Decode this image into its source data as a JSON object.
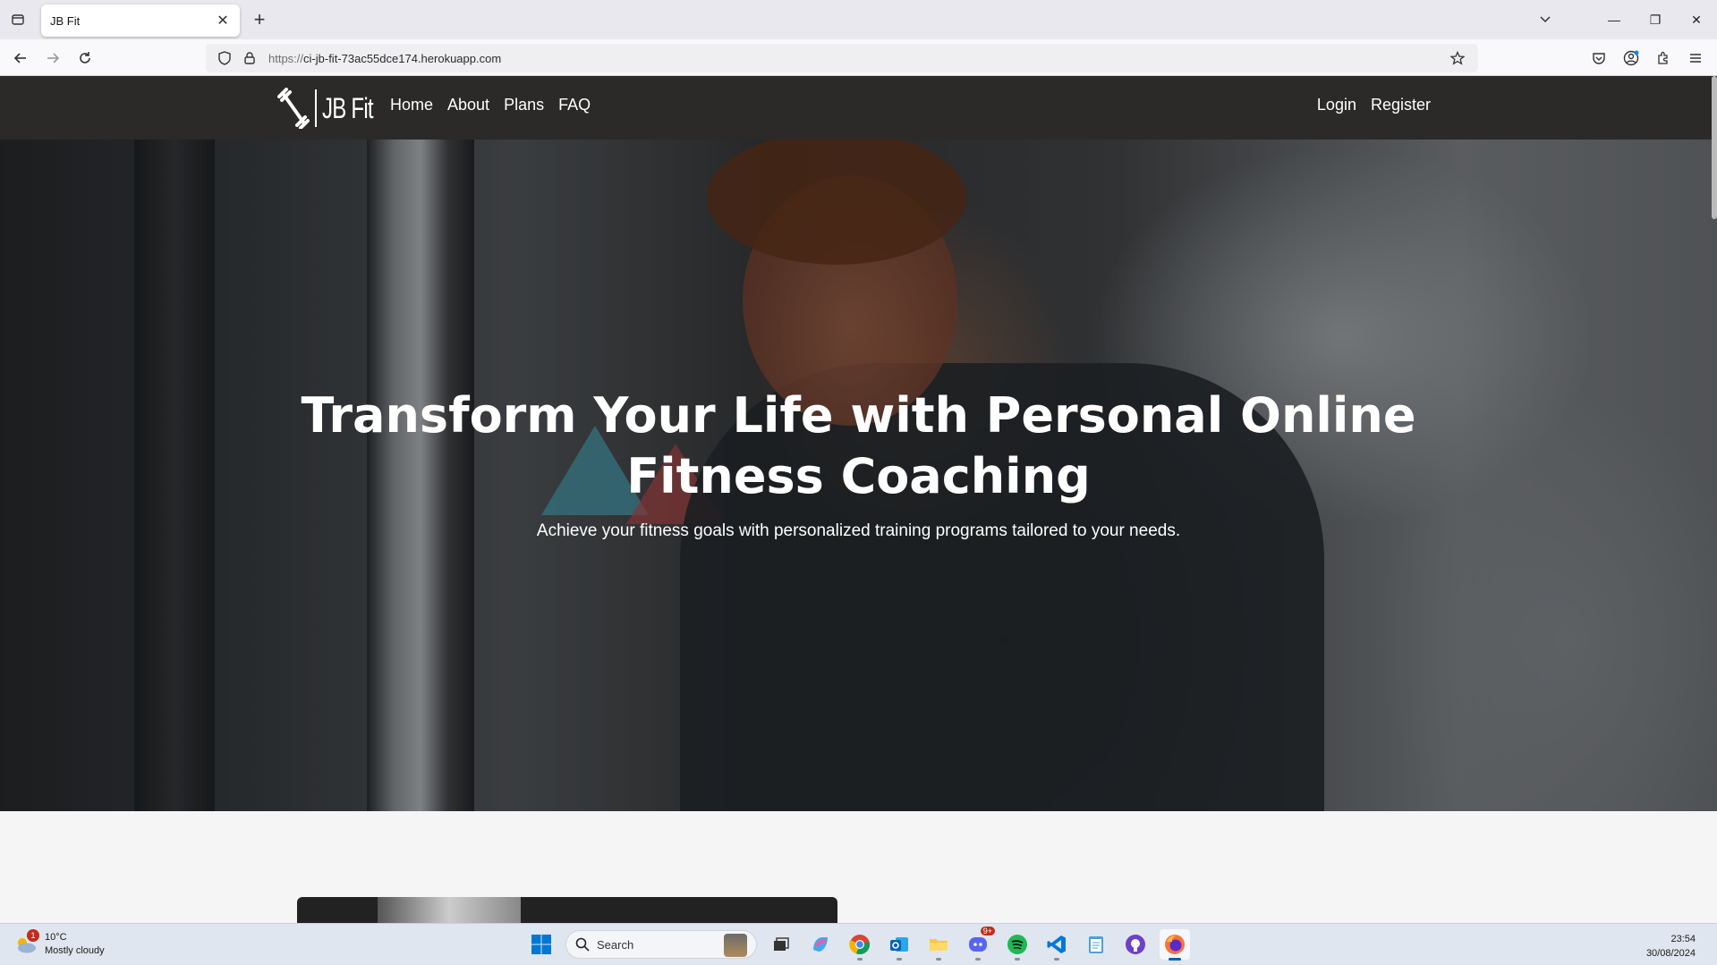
{
  "browser": {
    "tab_title": "JB Fit",
    "url_scheme": "https://",
    "url_rest": "ci-jb-fit-73ac55dce174.herokuapp.com"
  },
  "site": {
    "logo_text": "JB Fit",
    "nav": {
      "home": "Home",
      "about": "About",
      "plans": "Plans",
      "faq": "FAQ",
      "login": "Login",
      "register": "Register"
    },
    "hero": {
      "title_line1": "Transform Your Life with Personal Online",
      "title_line2": "Fitness Coaching",
      "subtitle": "Achieve your fitness goals with personalized training programs tailored to your needs."
    }
  },
  "taskbar": {
    "weather_badge": "1",
    "temperature": "10°C",
    "condition": "Mostly cloudy",
    "search_placeholder": "Search",
    "discord_badge": "9+",
    "time": "23:54",
    "date": "30/08/2024"
  },
  "colors": {
    "site_nav_bg": "#2b2a28",
    "hero_text": "#ffffff",
    "taskbar_bg": "#dfe6ef"
  }
}
